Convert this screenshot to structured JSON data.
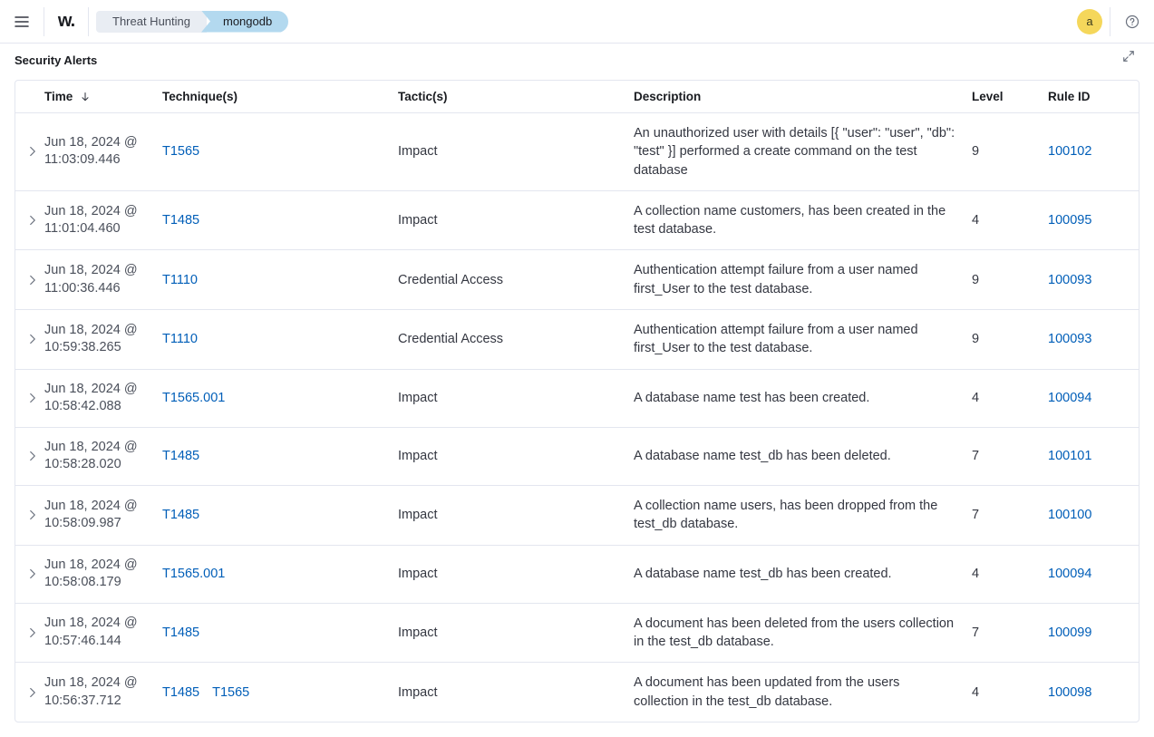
{
  "header": {
    "logo_text": "w.",
    "breadcrumb": {
      "first": "Threat Hunting",
      "second": "mongodb"
    },
    "avatar_initial": "a"
  },
  "panel": {
    "title": "Security Alerts"
  },
  "columns": {
    "time": "Time",
    "technique": "Technique(s)",
    "tactic": "Tactic(s)",
    "description": "Description",
    "level": "Level",
    "rule_id": "Rule ID"
  },
  "rows": [
    {
      "time_l1": "Jun 18, 2024 @",
      "time_l2": "11:03:09.446",
      "techniques": [
        "T1565"
      ],
      "tactic": "Impact",
      "description": "An unauthorized user with details [{ \"user\": \"user\", \"db\": \"test\" }] performed a create command on the test database",
      "level": "9",
      "rule_id": "100102"
    },
    {
      "time_l1": "Jun 18, 2024 @",
      "time_l2": "11:01:04.460",
      "techniques": [
        "T1485"
      ],
      "tactic": "Impact",
      "description": "A collection name customers, has been created in the test database.",
      "level": "4",
      "rule_id": "100095"
    },
    {
      "time_l1": "Jun 18, 2024 @",
      "time_l2": "11:00:36.446",
      "techniques": [
        "T1110"
      ],
      "tactic": "Credential Access",
      "description": "Authentication attempt failure from a user named first_User to the test database.",
      "level": "9",
      "rule_id": "100093"
    },
    {
      "time_l1": "Jun 18, 2024 @",
      "time_l2": "10:59:38.265",
      "techniques": [
        "T1110"
      ],
      "tactic": "Credential Access",
      "description": "Authentication attempt failure from a user named first_User to the test database.",
      "level": "9",
      "rule_id": "100093"
    },
    {
      "time_l1": "Jun 18, 2024 @",
      "time_l2": "10:58:42.088",
      "techniques": [
        "T1565.001"
      ],
      "tactic": "Impact",
      "description": "A database name test has been created.",
      "level": "4",
      "rule_id": "100094"
    },
    {
      "time_l1": "Jun 18, 2024 @",
      "time_l2": "10:58:28.020",
      "techniques": [
        "T1485"
      ],
      "tactic": "Impact",
      "description": "A database name test_db has been deleted.",
      "level": "7",
      "rule_id": "100101"
    },
    {
      "time_l1": "Jun 18, 2024 @",
      "time_l2": "10:58:09.987",
      "techniques": [
        "T1485"
      ],
      "tactic": "Impact",
      "description": "A collection name users, has been dropped from the test_db database.",
      "level": "7",
      "rule_id": "100100"
    },
    {
      "time_l1": "Jun 18, 2024 @",
      "time_l2": "10:58:08.179",
      "techniques": [
        "T1565.001"
      ],
      "tactic": "Impact",
      "description": "A database name test_db has been created.",
      "level": "4",
      "rule_id": "100094"
    },
    {
      "time_l1": "Jun 18, 2024 @",
      "time_l2": "10:57:46.144",
      "techniques": [
        "T1485"
      ],
      "tactic": "Impact",
      "description": "A document has been deleted from the users collection in the test_db database.",
      "level": "7",
      "rule_id": "100099"
    },
    {
      "time_l1": "Jun 18, 2024 @",
      "time_l2": "10:56:37.712",
      "techniques": [
        "T1485",
        "T1565"
      ],
      "tactic": "Impact",
      "description": "A document has been updated from the users collection in the test_db database.",
      "level": "4",
      "rule_id": "100098"
    }
  ]
}
